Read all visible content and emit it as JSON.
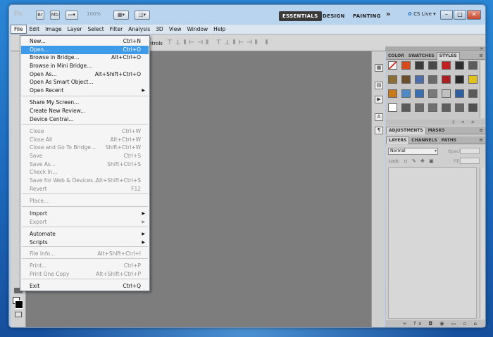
{
  "app": {
    "logo": "Ps",
    "zoom": "100%",
    "workspaces": [
      "ESSENTIALS",
      "DESIGN",
      "PAINTING"
    ],
    "more": "»",
    "cs_live": "CS Live ▾",
    "minimize": "–",
    "maximize": "□",
    "close": "✕",
    "bridge_btn": "Br",
    "minibridge_btn": "Mb"
  },
  "menubar": [
    "File",
    "Edit",
    "Image",
    "Layer",
    "Select",
    "Filter",
    "Analysis",
    "3D",
    "View",
    "Window",
    "Help"
  ],
  "options_bar": {
    "controls_label": "Controls",
    "icons": "⊤⊥⫴⊢⊣⫴ ⊤⊥⫴⊢⊣⫴ ⫴"
  },
  "file_menu": {
    "items": [
      {
        "label": "New...",
        "shortcut": "Ctrl+N",
        "enabled": true
      },
      {
        "label": "Open...",
        "shortcut": "Ctrl+O",
        "enabled": true,
        "highlighted": true
      },
      {
        "label": "Browse in Bridge...",
        "shortcut": "Alt+Ctrl+O",
        "enabled": true
      },
      {
        "label": "Browse in Mini Bridge...",
        "shortcut": "",
        "enabled": true
      },
      {
        "label": "Open As...",
        "shortcut": "Alt+Shift+Ctrl+O",
        "enabled": true
      },
      {
        "label": "Open As Smart Object...",
        "shortcut": "",
        "enabled": true
      },
      {
        "label": "Open Recent",
        "shortcut": "",
        "enabled": true,
        "submenu": true
      },
      {
        "label": "Share My Screen...",
        "shortcut": "",
        "enabled": true
      },
      {
        "label": "Create New Review...",
        "shortcut": "",
        "enabled": true
      },
      {
        "label": "Device Central...",
        "shortcut": "",
        "enabled": true
      },
      {
        "label": "Close",
        "shortcut": "Ctrl+W",
        "enabled": false
      },
      {
        "label": "Close All",
        "shortcut": "Alt+Ctrl+W",
        "enabled": false
      },
      {
        "label": "Close and Go To Bridge...",
        "shortcut": "Shift+Ctrl+W",
        "enabled": false
      },
      {
        "label": "Save",
        "shortcut": "Ctrl+S",
        "enabled": false
      },
      {
        "label": "Save As...",
        "shortcut": "Shift+Ctrl+S",
        "enabled": false
      },
      {
        "label": "Check In...",
        "shortcut": "",
        "enabled": false
      },
      {
        "label": "Save for Web & Devices...",
        "shortcut": "Alt+Shift+Ctrl+S",
        "enabled": false
      },
      {
        "label": "Revert",
        "shortcut": "F12",
        "enabled": false
      },
      {
        "label": "Place...",
        "shortcut": "",
        "enabled": false
      },
      {
        "label": "Import",
        "shortcut": "",
        "enabled": true,
        "submenu": true
      },
      {
        "label": "Export",
        "shortcut": "",
        "enabled": false,
        "submenu": true
      },
      {
        "label": "Automate",
        "shortcut": "",
        "enabled": true,
        "submenu": true
      },
      {
        "label": "Scripts",
        "shortcut": "",
        "enabled": true,
        "submenu": true
      },
      {
        "label": "File Info...",
        "shortcut": "Alt+Shift+Ctrl+I",
        "enabled": false
      },
      {
        "label": "Print...",
        "shortcut": "Ctrl+P",
        "enabled": false
      },
      {
        "label": "Print One Copy",
        "shortcut": "Alt+Shift+Ctrl+P",
        "enabled": false
      },
      {
        "label": "Exit",
        "shortcut": "Ctrl+Q",
        "enabled": true
      }
    ],
    "submenu_arrow": "▶"
  },
  "panels": {
    "swatches_tabs": [
      "COLOR",
      "SWATCHES",
      "STYLES"
    ],
    "adjust_tabs": [
      "ADJUSTMENTS",
      "MASKS"
    ],
    "layers_tabs": [
      "LAYERS",
      "CHANNELS",
      "PATHS"
    ],
    "blend_mode": "Normal",
    "opacity_label": "Opacity:",
    "lock_label": "Lock:",
    "fill_label": "Fill:",
    "menu_icon": "≡",
    "collapse_icon": "»",
    "styles_footer": "◊ ▫ ⌂",
    "layers_footer": "∞ fx ◘ ◉ ▭ ▫ ⌂",
    "lock_icons": "▫ ✎ ✥ ▣",
    "dropdown_arrow": "▾"
  },
  "style_swatches": [
    "#f4f4f4",
    "#d84a1a",
    "#3b3b3b",
    "#4a4a4a",
    "#c41f1f",
    "#2f2f2f",
    "#5c5c5c",
    "#8b6e35",
    "#6b4f2a",
    "#4d6ea8",
    "#6a6a6a",
    "#a82020",
    "#2a2a2a",
    "#e3c21a",
    "#c97a1a",
    "#4d88c7",
    "#3a6fb0",
    "#7a7a7a",
    "#c0c0c0",
    "#2d5fa0",
    "#5a5a5a",
    "#ffffff",
    "#5a5a5a",
    "#6a6a6a",
    "#707070",
    "#5e5e5e",
    "#666666",
    "#505050"
  ],
  "strip_icons": [
    "▦",
    "▤",
    "▶",
    "A",
    "¶"
  ]
}
